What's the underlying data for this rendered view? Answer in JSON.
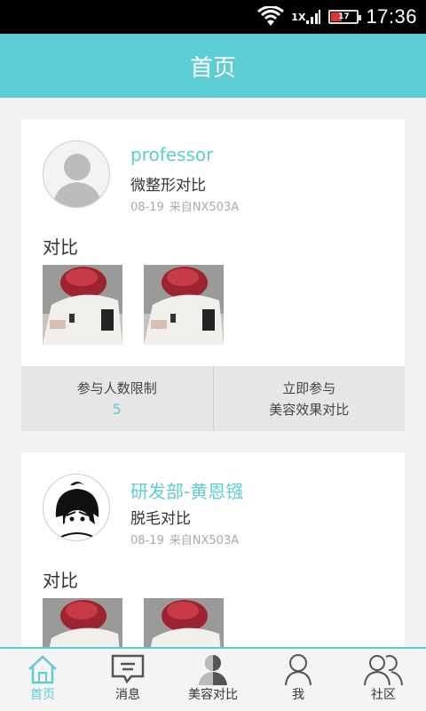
{
  "status_bar": {
    "time": "17:36",
    "battery_level": "17",
    "network": "1X"
  },
  "header": {
    "title": "首页"
  },
  "feed": {
    "posts": [
      {
        "author": "professor",
        "subject": "微整形对比",
        "date": "08-19",
        "source": "来自NX503A",
        "section_label": "对比",
        "avatar_icon": "default-user-icon",
        "actions": {
          "limit_label": "参与人数限制",
          "limit_value": "5",
          "join_line1": "立即参与",
          "join_line2": "美容效果对比"
        }
      },
      {
        "author": "研发部-黄恩镪",
        "subject": "脱毛对比",
        "date": "08-19",
        "source": "来自NX503A",
        "section_label": "对比",
        "avatar_icon": "anime-avatar-icon"
      }
    ]
  },
  "bottom_nav": {
    "items": [
      {
        "label": "首页",
        "icon": "home-icon",
        "active": true
      },
      {
        "label": "消息",
        "icon": "message-icon",
        "active": false
      },
      {
        "label": "美容对比",
        "icon": "compare-icon",
        "active": false
      },
      {
        "label": "我",
        "icon": "person-icon",
        "active": false
      },
      {
        "label": "社区",
        "icon": "community-icon",
        "active": false
      }
    ]
  },
  "colors": {
    "accent": "#5ccdd3",
    "status_bar": "#000000",
    "card_background": "#ffffff",
    "page_background": "#f2f2f2",
    "action_bar": "#e6e6e6"
  }
}
